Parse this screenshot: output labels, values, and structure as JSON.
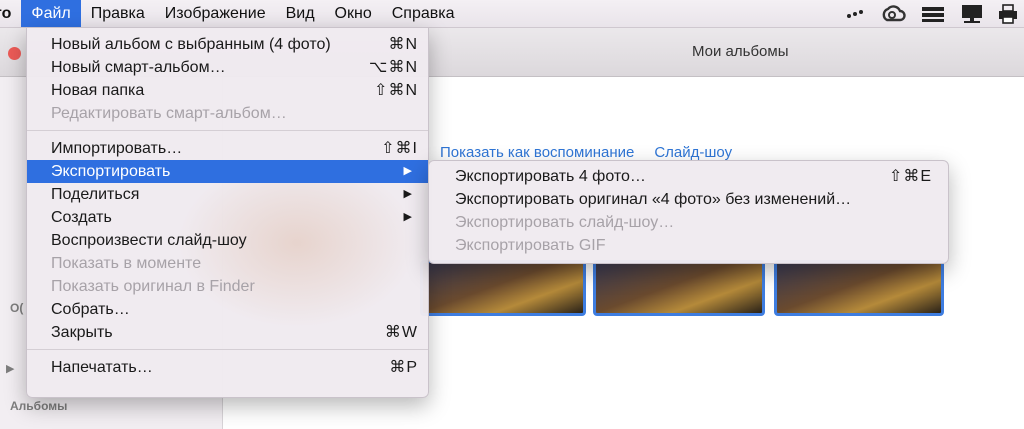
{
  "menubar": {
    "app_fragment": "то",
    "items": [
      "Файл",
      "Правка",
      "Изображение",
      "Вид",
      "Окно",
      "Справка"
    ],
    "active_index": 0
  },
  "window": {
    "title": "Мои альбомы",
    "links": [
      "Показать как воспоминание",
      "Слайд-шоу"
    ],
    "sidebar": {
      "albums_heading": "Альбомы",
      "fragment": "О("
    }
  },
  "file_menu": {
    "groups": [
      [
        {
          "label": "Новый альбом с выбранным (4 фото)",
          "shortcut": "⌘N",
          "enabled": true
        },
        {
          "label": "Новый смарт-альбом…",
          "shortcut": "⌥⌘N",
          "enabled": true
        },
        {
          "label": "Новая папка",
          "shortcut": "⇧⌘N",
          "enabled": true
        },
        {
          "label": "Редактировать смарт-альбом…",
          "shortcut": "",
          "enabled": false
        }
      ],
      [
        {
          "label": "Импортировать…",
          "shortcut": "⇧⌘I",
          "enabled": true
        },
        {
          "label": "Экспортировать",
          "shortcut": "",
          "submenu": true,
          "highlighted": true,
          "enabled": true
        },
        {
          "label": "Поделиться",
          "shortcut": "",
          "submenu": true,
          "enabled": true
        },
        {
          "label": "Создать",
          "shortcut": "",
          "submenu": true,
          "enabled": true
        },
        {
          "label": "Воспроизвести слайд-шоу",
          "shortcut": "",
          "enabled": true
        },
        {
          "label": "Показать в моменте",
          "shortcut": "",
          "enabled": false
        },
        {
          "label": "Показать оригинал в Finder",
          "shortcut": "",
          "enabled": false
        },
        {
          "label": "Собрать…",
          "shortcut": "",
          "enabled": true
        },
        {
          "label": "Закрыть",
          "shortcut": "⌘W",
          "enabled": true
        }
      ],
      [
        {
          "label": "Напечатать…",
          "shortcut": "⌘P",
          "enabled": true
        }
      ]
    ]
  },
  "export_submenu": {
    "items": [
      {
        "label": "Экспортировать 4 фото…",
        "shortcut": "⇧⌘E",
        "enabled": true
      },
      {
        "label": "Экспортировать оригинал «4 фото» без изменений…",
        "shortcut": "",
        "enabled": true
      },
      {
        "label": "Экспортировать слайд-шоу…",
        "shortcut": "",
        "enabled": false
      },
      {
        "label": "Экспортировать GIF",
        "shortcut": "",
        "enabled": false
      }
    ]
  },
  "icons": {
    "status": [
      "more-dots-icon",
      "creative-cloud-icon",
      "server-stack-icon",
      "monitor-network-icon",
      "printer-icon"
    ],
    "submenu_arrow": "triangle-right-icon"
  },
  "colors": {
    "highlight": "#2f6fe0",
    "link": "#2f76d6",
    "disabled_text": "#a7a2a8",
    "close_button": "#ec5b57"
  }
}
